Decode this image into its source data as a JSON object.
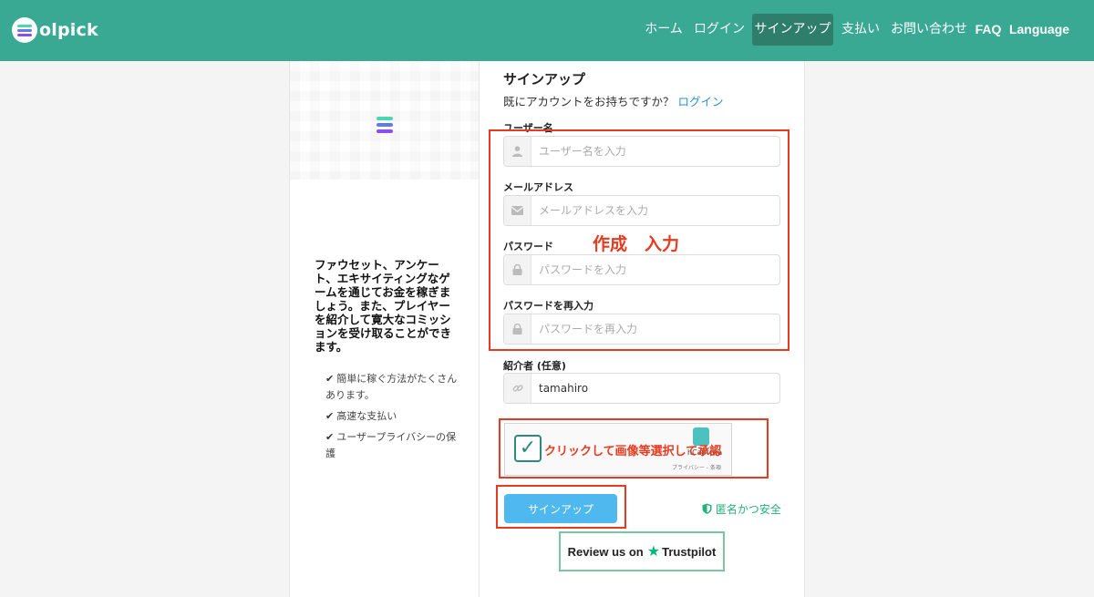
{
  "brand": {
    "logo_text": "olpick"
  },
  "nav": {
    "items": [
      "ホーム",
      "ログイン",
      "サインアップ",
      "支払い",
      "お問い合わせ",
      "FAQ",
      "Language"
    ],
    "active": "サインアップ"
  },
  "left": {
    "tagline": "ファウセット、アンケート、エキサイティングなゲームを通じてお金を稼ぎましょう。また、プレイヤーを紹介して寛大なコミッションを受け取ることができます。",
    "features": [
      "簡単に稼ぐ方法がたくさんあります。",
      "高速な支払い",
      "ユーザープライバシーの保護"
    ]
  },
  "form": {
    "title": "サインアップ",
    "have_account": "既にアカウントをお持ちですか？",
    "login_link": "ログイン",
    "username": {
      "label": "ユーザー名",
      "placeholder": "ユーザー名を入力"
    },
    "email": {
      "label": "メールアドレス",
      "placeholder": "メールアドレスを入力"
    },
    "password": {
      "label": "パスワード",
      "placeholder": "パスワードを入力"
    },
    "password_confirm": {
      "label": "パスワードを再入力",
      "placeholder": "パスワードを再入力"
    },
    "referrer": {
      "label": "紹介者 (任意)",
      "value": "tamahiro"
    },
    "captcha": {
      "brand": "hCaptcha",
      "links": "プライバシー - 条項"
    },
    "submit": "サインアップ",
    "secure": "匿名かつ安全"
  },
  "trustpilot": {
    "prefix": "Review us on",
    "brand": "Trustpilot"
  },
  "annotations": {
    "create_input": "作成　入力",
    "captcha_hint": "クリックして画像等選択して承認"
  },
  "colors": {
    "nav_bg": "#3aa994",
    "nav_active": "#2e7e6b",
    "annotation": "#e63b1f",
    "submit": "#4fb8ee"
  }
}
